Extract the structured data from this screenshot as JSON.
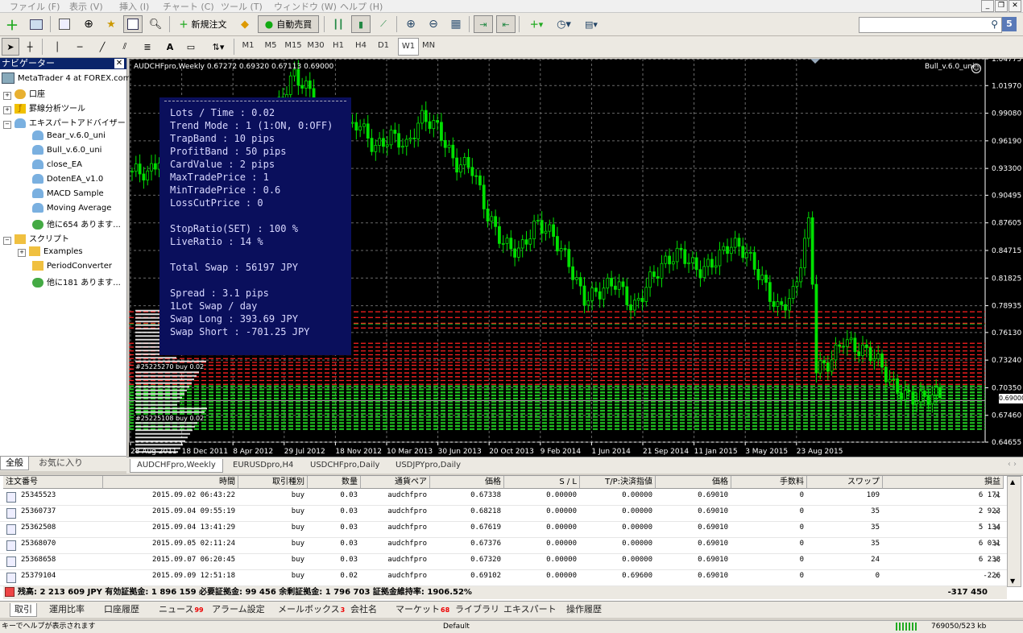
{
  "menu": [
    "ファイル (F)",
    "表示 (V)",
    "挿入 (I)",
    "チャート (C)",
    "ツール (T)",
    "ウィンドウ (W)",
    "ヘルプ (H)"
  ],
  "toolbar": {
    "new_order": "新規注文",
    "auto_trade": "自動売買",
    "search_count": "5",
    "timeframes": [
      "M1",
      "M5",
      "M15",
      "M30",
      "H1",
      "H4",
      "D1",
      "W1",
      "MN"
    ],
    "active_timeframe": "W1",
    "text_tool": "A"
  },
  "navigator": {
    "title": "ナビゲーター",
    "root": "MetaTrader 4 at FOREX.com",
    "items": [
      {
        "label": "口座",
        "icon": "accounts-icon"
      },
      {
        "label": "罫線分析ツール",
        "icon": "indicators-icon"
      },
      {
        "label": "エキスパートアドバイザー",
        "icon": "expert-icon"
      },
      {
        "label": "Bear_v.6.0_uni",
        "icon": "ea-icon"
      },
      {
        "label": "Bull_v.6.0_uni",
        "icon": "ea-icon"
      },
      {
        "label": "close_EA",
        "icon": "ea-icon"
      },
      {
        "label": "DotenEA_v1.0",
        "icon": "ea-icon"
      },
      {
        "label": "MACD Sample",
        "icon": "ea-icon"
      },
      {
        "label": "Moving Average",
        "icon": "ea-icon"
      },
      {
        "label": "他に654 あります...",
        "icon": "globe-icon"
      },
      {
        "label": "スクリプト",
        "icon": "script-icon"
      },
      {
        "label": "Examples",
        "icon": "folder-icon"
      },
      {
        "label": "PeriodConverter",
        "icon": "script-icon"
      },
      {
        "label": "他に181 あります...",
        "icon": "globe-icon"
      }
    ],
    "tabs": [
      "全般",
      "お気に入り"
    ]
  },
  "chart": {
    "header": "AUDCHFpro,Weekly  0.67272 0.69320 0.67113 0.69000",
    "ea_label": "Bull_v.6.0_uni",
    "current_price": "0.69000",
    "price_axis": [
      "1.04775",
      "1.01970",
      "0.99080",
      "0.96190",
      "0.93300",
      "0.90495",
      "0.87605",
      "0.84715",
      "0.81825",
      "0.78935",
      "0.76130",
      "0.73240",
      "0.70350",
      "0.67460",
      "0.64655"
    ],
    "date_axis": [
      "28 Aug 2011",
      "18 Dec 2011",
      "8 Apr 2012",
      "29 Jul 2012",
      "18 Nov 2012",
      "10 Mar 2013",
      "30 Jun 2013",
      "20 Oct 2013",
      "9 Feb 2014",
      "1 Jun 2014",
      "21 Sep 2014",
      "11 Jan 2015",
      "3 May 2015",
      "23 Aug 2015"
    ],
    "info_lines": [
      "Lots / Time : 0.02",
      "Trend Mode  : 1  (1:ON, 0:OFF)",
      "TrapBand  : 10  pips",
      "ProfitBand  : 50  pips",
      "CardValue   : 2  pips",
      "MaxTradePrice  : 1",
      "MinTradePrice  : 0.6",
      "LossCutPrice   : 0",
      "",
      "StopRatio(SET) : 100 %",
      "LiveRatio   : 14 %",
      "",
      "Total Swap  : 56197 JPY",
      "",
      "Spread : 3.1 pips",
      "1Lot Swap / day",
      "  Swap Long  : 393.69 JPY",
      "  Swap Short : -701.25 JPY"
    ],
    "order_label_1": "#25225270 buy 0.02",
    "order_label_2": "#25225108 buy 0.02"
  },
  "chart_data": {
    "type": "candlestick",
    "title": "AUDCHFpro,Weekly",
    "x_range": [
      "28 Aug 2011",
      "23 Aug 2015"
    ],
    "ylim": [
      0.64655,
      1.04775
    ],
    "close_path": [
      [
        0.0,
        0.93
      ],
      [
        0.02,
        0.92
      ],
      [
        0.04,
        0.95
      ],
      [
        0.06,
        0.93
      ],
      [
        0.08,
        0.96
      ],
      [
        0.1,
        0.94
      ],
      [
        0.12,
        0.97
      ],
      [
        0.14,
        0.96
      ],
      [
        0.16,
        0.94
      ],
      [
        0.18,
        0.99
      ],
      [
        0.2,
        1.03
      ],
      [
        0.22,
        1.02
      ],
      [
        0.24,
        0.97
      ],
      [
        0.26,
        0.96
      ],
      [
        0.28,
        0.98
      ],
      [
        0.3,
        0.96
      ],
      [
        0.32,
        0.97
      ],
      [
        0.34,
        0.95
      ],
      [
        0.36,
        0.985
      ],
      [
        0.38,
        0.98
      ],
      [
        0.4,
        0.94
      ],
      [
        0.42,
        0.93
      ],
      [
        0.44,
        0.88
      ],
      [
        0.46,
        0.86
      ],
      [
        0.48,
        0.85
      ],
      [
        0.5,
        0.87
      ],
      [
        0.52,
        0.86
      ],
      [
        0.54,
        0.84
      ],
      [
        0.56,
        0.8
      ],
      [
        0.58,
        0.8
      ],
      [
        0.6,
        0.81
      ],
      [
        0.62,
        0.79
      ],
      [
        0.64,
        0.82
      ],
      [
        0.66,
        0.83
      ],
      [
        0.68,
        0.84
      ],
      [
        0.7,
        0.83
      ],
      [
        0.72,
        0.84
      ],
      [
        0.74,
        0.85
      ],
      [
        0.76,
        0.84
      ],
      [
        0.78,
        0.82
      ],
      [
        0.8,
        0.79
      ],
      [
        0.82,
        0.8
      ],
      [
        0.84,
        0.88
      ],
      [
        0.845,
        0.72
      ],
      [
        0.86,
        0.73
      ],
      [
        0.88,
        0.76
      ],
      [
        0.9,
        0.74
      ],
      [
        0.92,
        0.73
      ],
      [
        0.94,
        0.71
      ],
      [
        0.96,
        0.7
      ],
      [
        0.98,
        0.69
      ],
      [
        1.0,
        0.69
      ]
    ]
  },
  "chart_tabs": [
    "AUDCHFpro,Weekly",
    "EURUSDpro,H4",
    "USDCHFpro,Daily",
    "USDJPYpro,Daily"
  ],
  "terminal": {
    "headers": [
      "注文番号",
      "時間",
      "取引種別",
      "数量",
      "通貨ペア",
      "価格",
      "S / L",
      "T/P:決済指値",
      "価格",
      "手数料",
      "スワップ",
      "損益"
    ],
    "rows": [
      [
        "25345523",
        "2015.09.02 06:43:22",
        "buy",
        "0.03",
        "audchfpro",
        "0.67338",
        "0.00000",
        "0.00000",
        "0.69010",
        "0",
        "109",
        "6 171"
      ],
      [
        "25360737",
        "2015.09.04 09:55:19",
        "buy",
        "0.03",
        "audchfpro",
        "0.68218",
        "0.00000",
        "0.00000",
        "0.69010",
        "0",
        "35",
        "2 923"
      ],
      [
        "25362508",
        "2015.09.04 13:41:29",
        "buy",
        "0.03",
        "audchfpro",
        "0.67619",
        "0.00000",
        "0.00000",
        "0.69010",
        "0",
        "35",
        "5 134"
      ],
      [
        "25368070",
        "2015.09.05 02:11:24",
        "buy",
        "0.03",
        "audchfpro",
        "0.67376",
        "0.00000",
        "0.00000",
        "0.69010",
        "0",
        "35",
        "6 031"
      ],
      [
        "25368658",
        "2015.09.07 06:20:45",
        "buy",
        "0.03",
        "audchfpro",
        "0.67320",
        "0.00000",
        "0.00000",
        "0.69010",
        "0",
        "24",
        "6 238"
      ],
      [
        "25379104",
        "2015.09.09 12:51:18",
        "buy",
        "0.02",
        "audchfpro",
        "0.69102",
        "0.00000",
        "0.69600",
        "0.69010",
        "0",
        "0",
        "-226"
      ]
    ],
    "balance_line": "残高: 2 213 609 JPY  有効証拠金: 1 896 159  必要証拠金: 99 456  余剰証拠金: 1 796 703  証拠金維持率: 1906.52%",
    "total_pl": "-317 450",
    "tabs": [
      {
        "label": "取引",
        "badge": ""
      },
      {
        "label": "運用比率",
        "badge": ""
      },
      {
        "label": "口座履歴",
        "badge": ""
      },
      {
        "label": "ニュース",
        "badge": "99"
      },
      {
        "label": "アラーム設定",
        "badge": ""
      },
      {
        "label": "メールボックス",
        "badge": "3"
      },
      {
        "label": "会社名",
        "badge": ""
      },
      {
        "label": "マーケット",
        "badge": "68"
      },
      {
        "label": "ライブラリ",
        "badge": ""
      },
      {
        "label": "エキスパート",
        "badge": ""
      },
      {
        "label": "操作履歴",
        "badge": ""
      }
    ]
  },
  "status": {
    "help": "キーでヘルプが表示されます",
    "profile": "Default",
    "traffic": "769050/523 kb"
  },
  "colors": {
    "candle": "#00e000",
    "chart_bg": "#000000",
    "info_bg": "#0a0f5c",
    "order_red": "#ff2020",
    "order_green": "#20c020",
    "nav_title": "#0a246a"
  }
}
